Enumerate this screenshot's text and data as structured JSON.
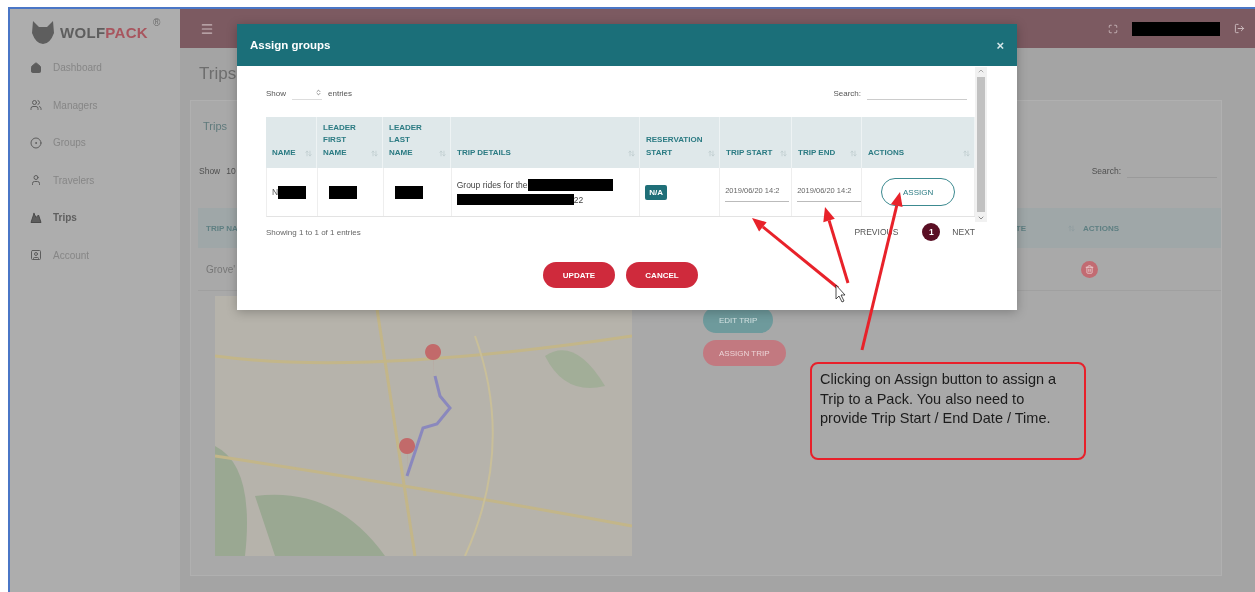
{
  "brand": {
    "part_1": "WOLF",
    "part_2": "PACK",
    "mark": "®"
  },
  "sidebar": {
    "items": [
      {
        "label": "Dashboard",
        "selected": false
      },
      {
        "label": "Managers",
        "selected": false
      },
      {
        "label": "Groups",
        "selected": false
      },
      {
        "label": "Travelers",
        "selected": false
      },
      {
        "label": "Trips",
        "selected": true
      },
      {
        "label": "Account",
        "selected": false
      }
    ]
  },
  "page": {
    "title": "Trips",
    "card": {
      "title": "Trips",
      "show_label": "Show",
      "show_value": "10",
      "search_label": "Search:",
      "columns": [
        {
          "label": "TRIP NA"
        },
        {
          "label": "TE"
        },
        {
          "label": "ACTIONS"
        }
      ],
      "rows": [
        {
          "trip_name": "Grove'"
        }
      ],
      "buttons": [
        {
          "label": "EDIT TRIP",
          "kind": "secondary"
        },
        {
          "label": "ASSIGN TRIP",
          "kind": "primary"
        }
      ]
    }
  },
  "modal": {
    "title": "Assign groups",
    "close": "×",
    "show_label": "Show",
    "entries_label": "entries",
    "search_label": "Search:",
    "columns": [
      {
        "label": "NAME"
      },
      {
        "label": "LEADER FIRST NAME"
      },
      {
        "label": "LEADER LAST NAME"
      },
      {
        "label": "TRIP DETAILS"
      },
      {
        "label": "RESERVATION START"
      },
      {
        "label": "TRIP START"
      },
      {
        "label": "TRIP END"
      },
      {
        "label": "ACTIONS"
      }
    ],
    "rows": [
      {
        "name": {
          "text": "N",
          "redacted": true
        },
        "leader_first_name": {
          "redacted": true
        },
        "leader_last_name": {
          "redacted": true
        },
        "trip_details": {
          "line_1": "Group rides for the",
          "line_2": "22",
          "redacted": true
        },
        "reservation_start": "N/A",
        "trip_start": "2019/06/20 14:2",
        "trip_end": "2019/06/20 14:2",
        "action": "ASSIGN"
      }
    ],
    "info": "Showing 1 to 1 of 1 entries",
    "pagination": {
      "previous": "PREVIOUS",
      "pages": [
        {
          "label": "1",
          "selected": true
        }
      ],
      "next": "NEXT"
    },
    "buttons": [
      {
        "label": "UPDATE"
      },
      {
        "label": "CANCEL"
      }
    ]
  },
  "annotation": {
    "callout": "Clicking on Assign button to assign a Trip to a Pack. You also need to provide Trip Start / End Date / Time."
  }
}
